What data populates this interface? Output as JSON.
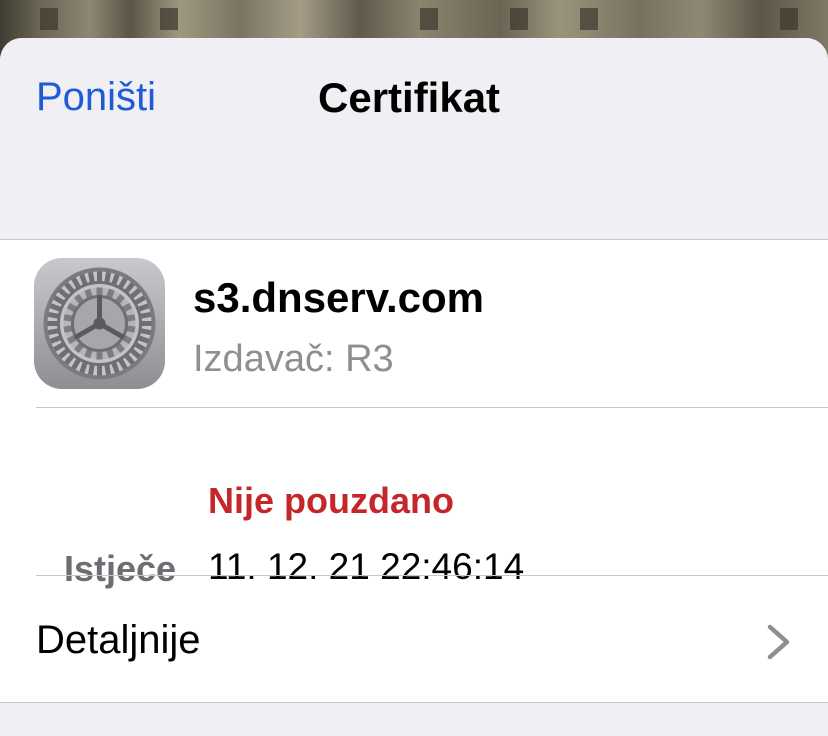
{
  "navbar": {
    "cancel_label": "Poništi",
    "title": "Certifikat"
  },
  "certificate": {
    "name": "s3.dnserv.com",
    "issuer": "Izdavač: R3",
    "icon": "settings-gear-icon"
  },
  "status": {
    "trust": "Nije pouzdano",
    "expires_label": "Istječe",
    "expires_value": "11. 12. 21 22:46:14"
  },
  "details": {
    "label": "Detaljnije",
    "icon": "chevron-right-icon"
  },
  "colors": {
    "accent": "#1f5bd6",
    "danger": "#c4262a",
    "secondary_text": "#8e8e93",
    "background": "#efeff4"
  }
}
